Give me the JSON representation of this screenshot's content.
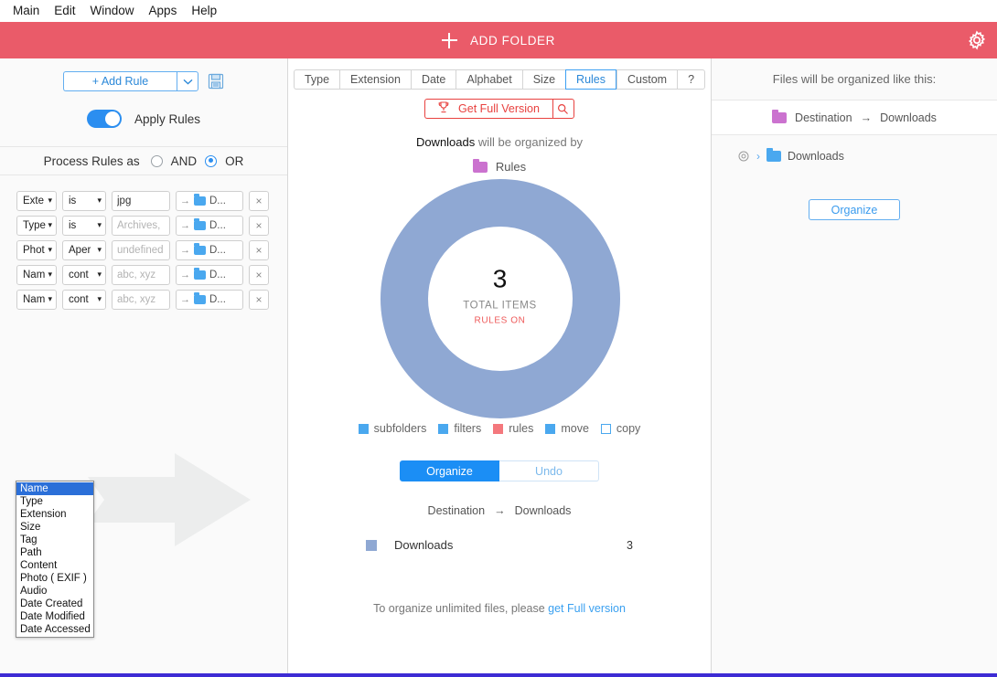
{
  "menubar": {
    "items": [
      "Main",
      "Edit",
      "Window",
      "Apps",
      "Help"
    ]
  },
  "header": {
    "add_folder_label": "ADD FOLDER",
    "gear_icon": "gear-icon",
    "bg_color": "#ea5b69"
  },
  "left_panel": {
    "add_rule_label": "+ Add Rule",
    "caret_icon": "chevron-down-icon",
    "save_icon": "floppy-save-icon",
    "apply_rules_label": "Apply Rules",
    "apply_rules_on": true,
    "process_rules_label": "Process Rules as",
    "and_label": "AND",
    "or_label": "OR",
    "selected_operator": "OR",
    "rules": [
      {
        "field": "Exte",
        "operator": "is",
        "value": "jpg",
        "placeholder": "",
        "destination": "D...",
        "remove_label": "×"
      },
      {
        "field": "Type",
        "operator": "is",
        "value": "",
        "placeholder": "Archives,",
        "destination": "D...",
        "remove_label": "×"
      },
      {
        "field": "Phot",
        "operator": "Aper",
        "value": "",
        "placeholder": "undefined",
        "destination": "D...",
        "remove_label": "×"
      },
      {
        "field": "Nam",
        "operator": "cont",
        "value": "",
        "placeholder": "abc, xyz",
        "destination": "D...",
        "remove_label": "×"
      },
      {
        "field": "Nam",
        "operator": "cont",
        "value": "",
        "placeholder": "abc, xyz",
        "destination": "D...",
        "remove_label": "×"
      }
    ],
    "dropdown": {
      "open": true,
      "selected": "Name",
      "options": [
        "Name",
        "Type",
        "Extension",
        "Size",
        "Tag",
        "Path",
        "Content",
        "Photo ( EXIF )",
        "Audio",
        "Date Created",
        "Date Modified",
        "Date Accessed"
      ]
    }
  },
  "center_panel": {
    "tabs": [
      {
        "label": "Type",
        "active": false
      },
      {
        "label": "Extension",
        "active": false
      },
      {
        "label": "Date",
        "active": false
      },
      {
        "label": "Alphabet",
        "active": false
      },
      {
        "label": "Size",
        "active": false
      },
      {
        "label": "Rules",
        "active": true
      },
      {
        "label": "Custom",
        "active": false
      },
      {
        "label": "?",
        "active": false
      }
    ],
    "get_full_version_label": "Get Full Version",
    "trophy_icon": "trophy-icon",
    "search_icon": "search-icon",
    "organized_by_prefix": "Downloads",
    "organized_by_suffix": " will be organized by",
    "organized_by_value": "Rules",
    "donut": {
      "total": "3",
      "total_label": "TOTAL ITEMS",
      "status_label": "RULES ON",
      "ring_color": "#8fa8d3"
    },
    "legend": [
      {
        "label": "subfolders",
        "color": "#4aa8ef",
        "hollow": false
      },
      {
        "label": "filters",
        "color": "#4aa8ef",
        "hollow": false
      },
      {
        "label": "rules",
        "color": "#f4787d",
        "hollow": false
      },
      {
        "label": "move",
        "color": "#4aa8ef",
        "hollow": false
      },
      {
        "label": "copy",
        "color": "#ffffff",
        "hollow": true
      }
    ],
    "organize_label": "Organize",
    "undo_label": "Undo",
    "destination_label": "Destination",
    "destination_arrow": "→",
    "destination_value": "Downloads",
    "result_row": {
      "name": "Downloads",
      "count": "3",
      "color": "#8fa8d3"
    },
    "footer_text": "To organize unlimited files, please ",
    "footer_link": "get Full version"
  },
  "right_panel": {
    "title": "Files will be organized like this:",
    "destination_label": "Destination",
    "destination_arrow": "→",
    "destination_value": "Downloads",
    "tree_gear_icon": "gear-icon",
    "tree_chevron": "›",
    "tree_item": "Downloads",
    "organize_label": "Organize"
  }
}
